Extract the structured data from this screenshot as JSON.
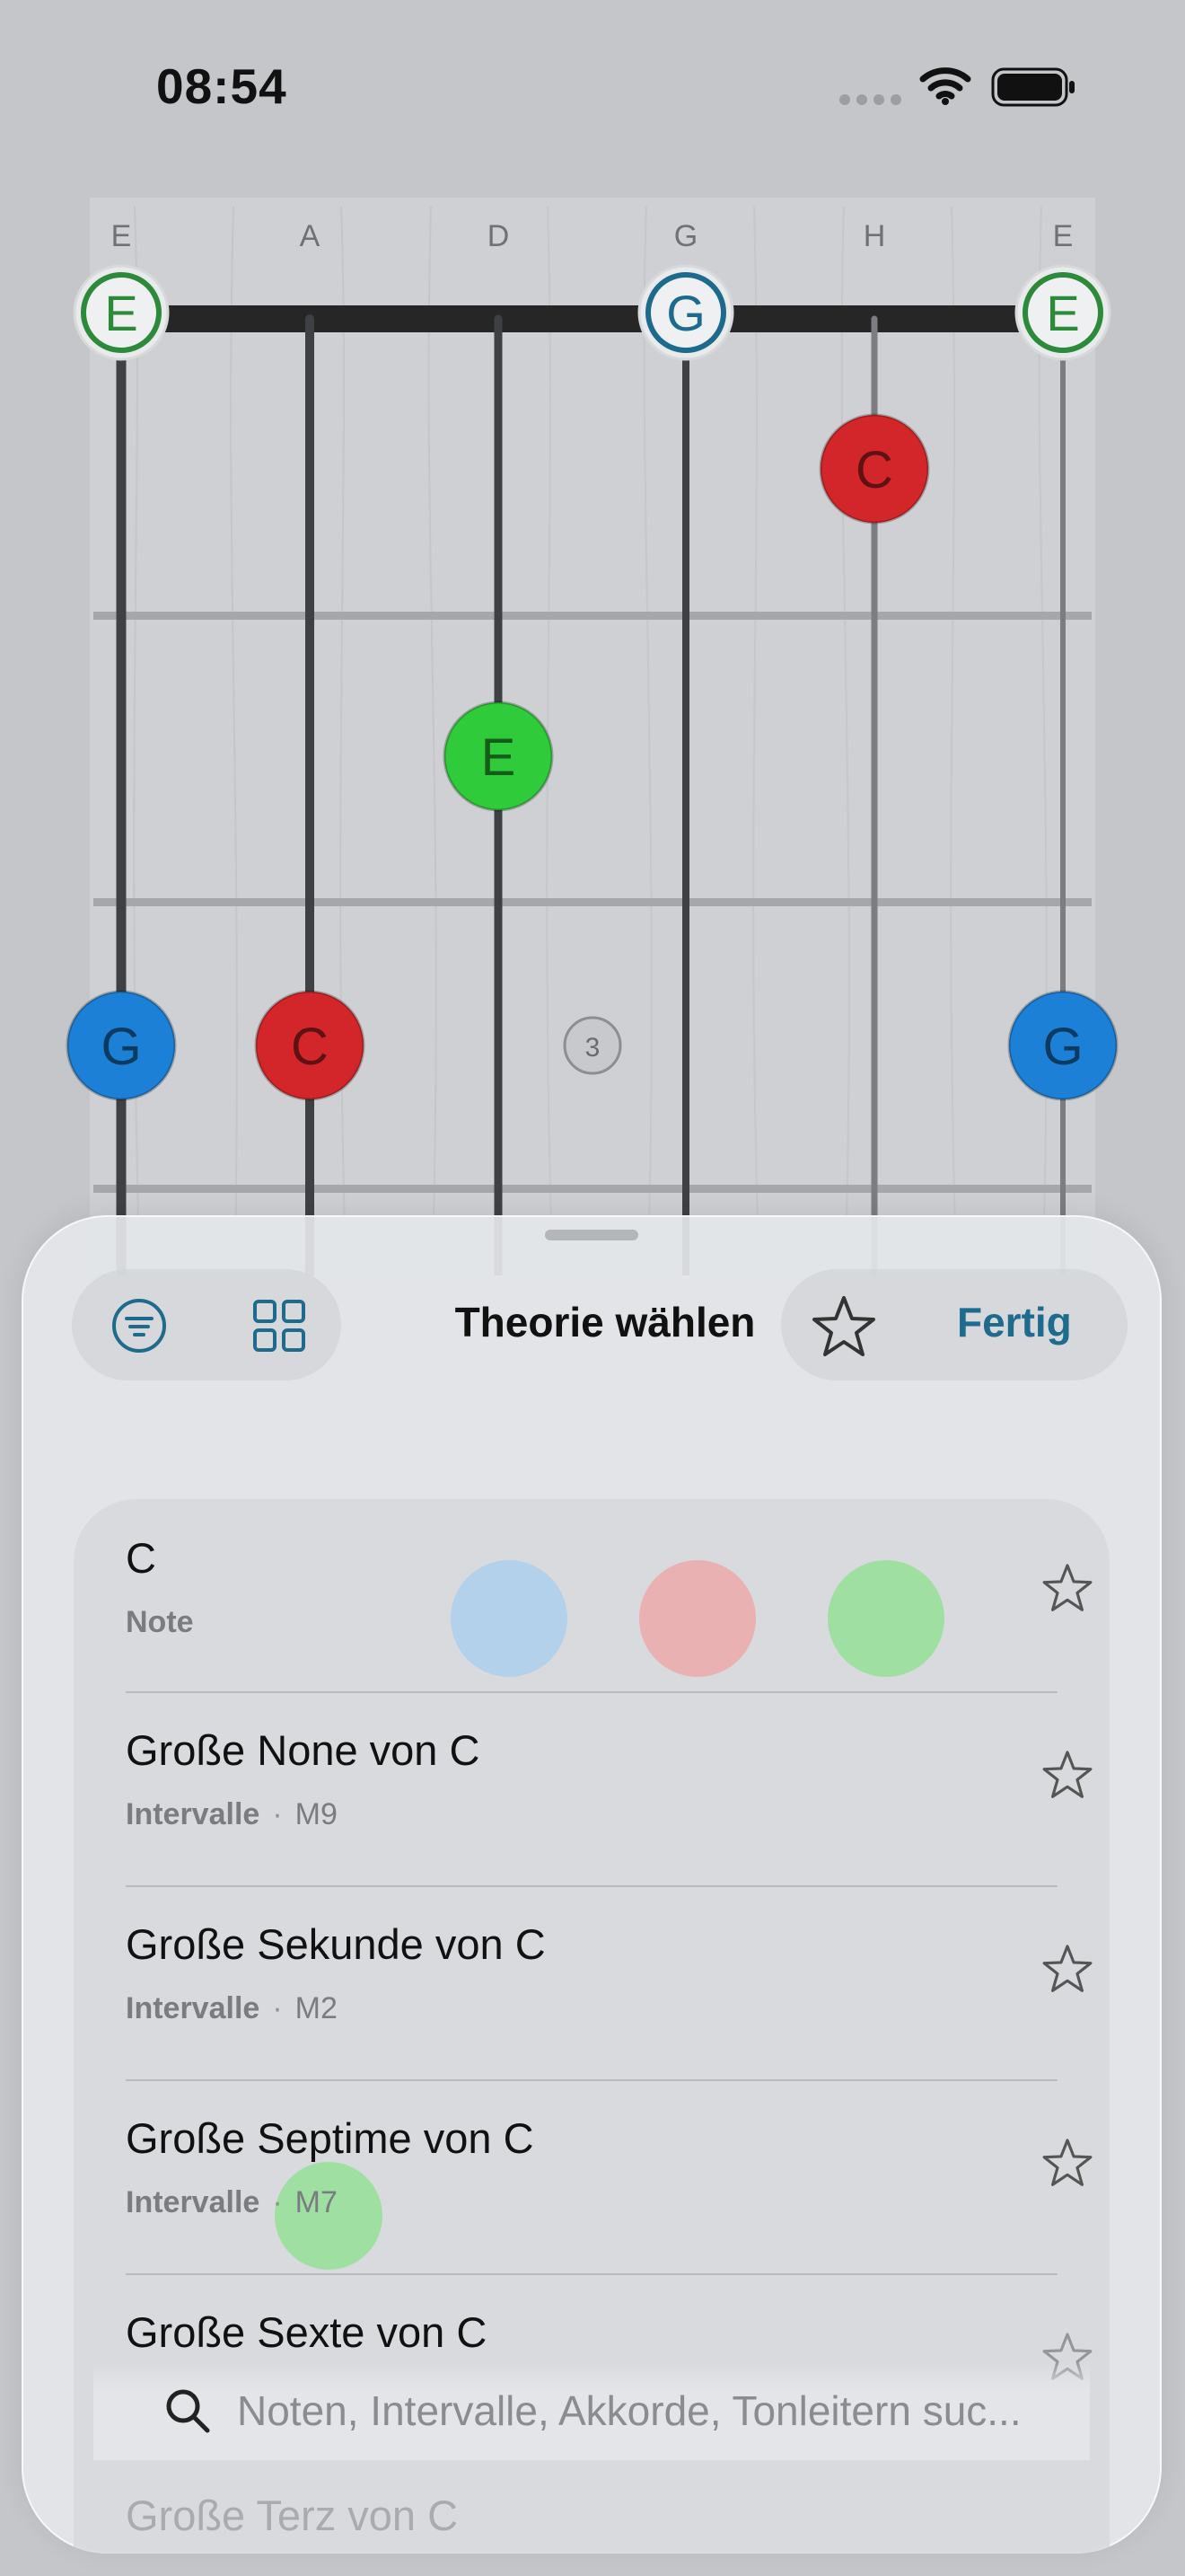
{
  "status_bar": {
    "time": "08:54"
  },
  "fretboard": {
    "string_names": [
      "E",
      "A",
      "D",
      "G",
      "H",
      "E"
    ],
    "open_notes": [
      {
        "string": 0,
        "label": "E",
        "color": "#2d8a3a",
        "style": "open"
      },
      {
        "string": 3,
        "label": "G",
        "color": "#1e6a8f",
        "style": "open"
      },
      {
        "string": 5,
        "label": "E",
        "color": "#2d8a3a",
        "style": "open"
      }
    ],
    "fretted_notes": [
      {
        "string": 4,
        "fret": 1,
        "label": "C",
        "color": "#d2262a"
      },
      {
        "string": 2,
        "fret": 2,
        "label": "E",
        "color": "#2fcb3a"
      },
      {
        "string": 0,
        "fret": 3,
        "label": "G",
        "color": "#1b80d6"
      },
      {
        "string": 1,
        "fret": 3,
        "label": "C",
        "color": "#d2262a"
      },
      {
        "string": 5,
        "fret": 3,
        "label": "G",
        "color": "#1b80d6"
      }
    ],
    "fret_marker": "3"
  },
  "sheet": {
    "title": "Theorie wählen",
    "done_label": "Fertig",
    "items": [
      {
        "title": "C",
        "category": "Note",
        "code": ""
      },
      {
        "title": "Große None von C",
        "category": "Intervalle",
        "code": "M9"
      },
      {
        "title": "Große Sekunde von C",
        "category": "Intervalle",
        "code": "M2"
      },
      {
        "title": "Große Septime von C",
        "category": "Intervalle",
        "code": "M7"
      },
      {
        "title": "Große Sexte von C",
        "category": "",
        "code": ""
      }
    ],
    "faded_item": "Große Terz von C",
    "search_placeholder": "Noten, Intervalle, Akkorde, Tonleitern suc..."
  },
  "colors": {
    "accent": "#1f6b8e"
  }
}
